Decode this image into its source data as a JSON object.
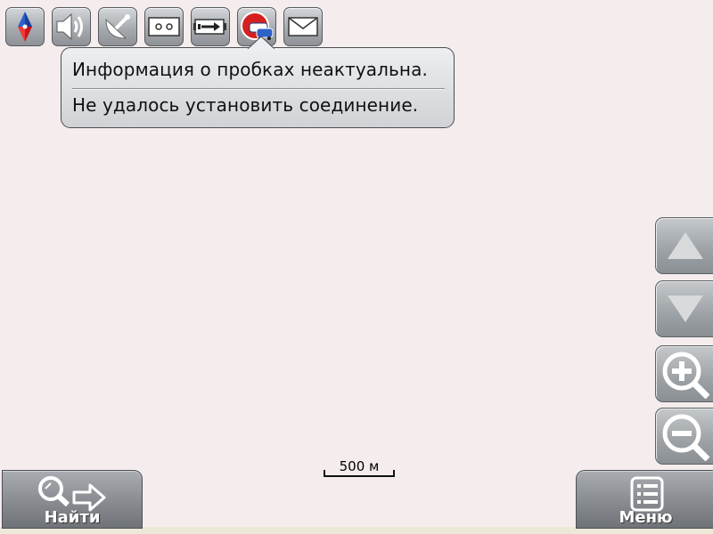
{
  "theme": {
    "map_bg": "#f5eded",
    "button_gray": "#9ca1a5",
    "traffic_red": "#d62020",
    "traffic_blue": "#2f62c8"
  },
  "toolbar": {
    "items": [
      {
        "icon": "compass-icon"
      },
      {
        "icon": "volume-icon"
      },
      {
        "icon": "satellite-dish-icon"
      },
      {
        "icon": "cassette-icon"
      },
      {
        "icon": "battery-charging-icon"
      },
      {
        "icon": "traffic-jam-icon"
      },
      {
        "icon": "mail-icon"
      }
    ]
  },
  "tooltip": {
    "line1": "Информация о пробках неактуальна.",
    "line2": "Не удалось установить соединение."
  },
  "map": {
    "scale_label": "500 м"
  },
  "side_controls": [
    {
      "icon": "arrow-up-icon"
    },
    {
      "icon": "arrow-down-icon"
    },
    {
      "icon": "zoom-in-icon"
    },
    {
      "icon": "zoom-out-icon"
    }
  ],
  "bottom": {
    "find_label": "Найти",
    "menu_label": "Меню"
  }
}
